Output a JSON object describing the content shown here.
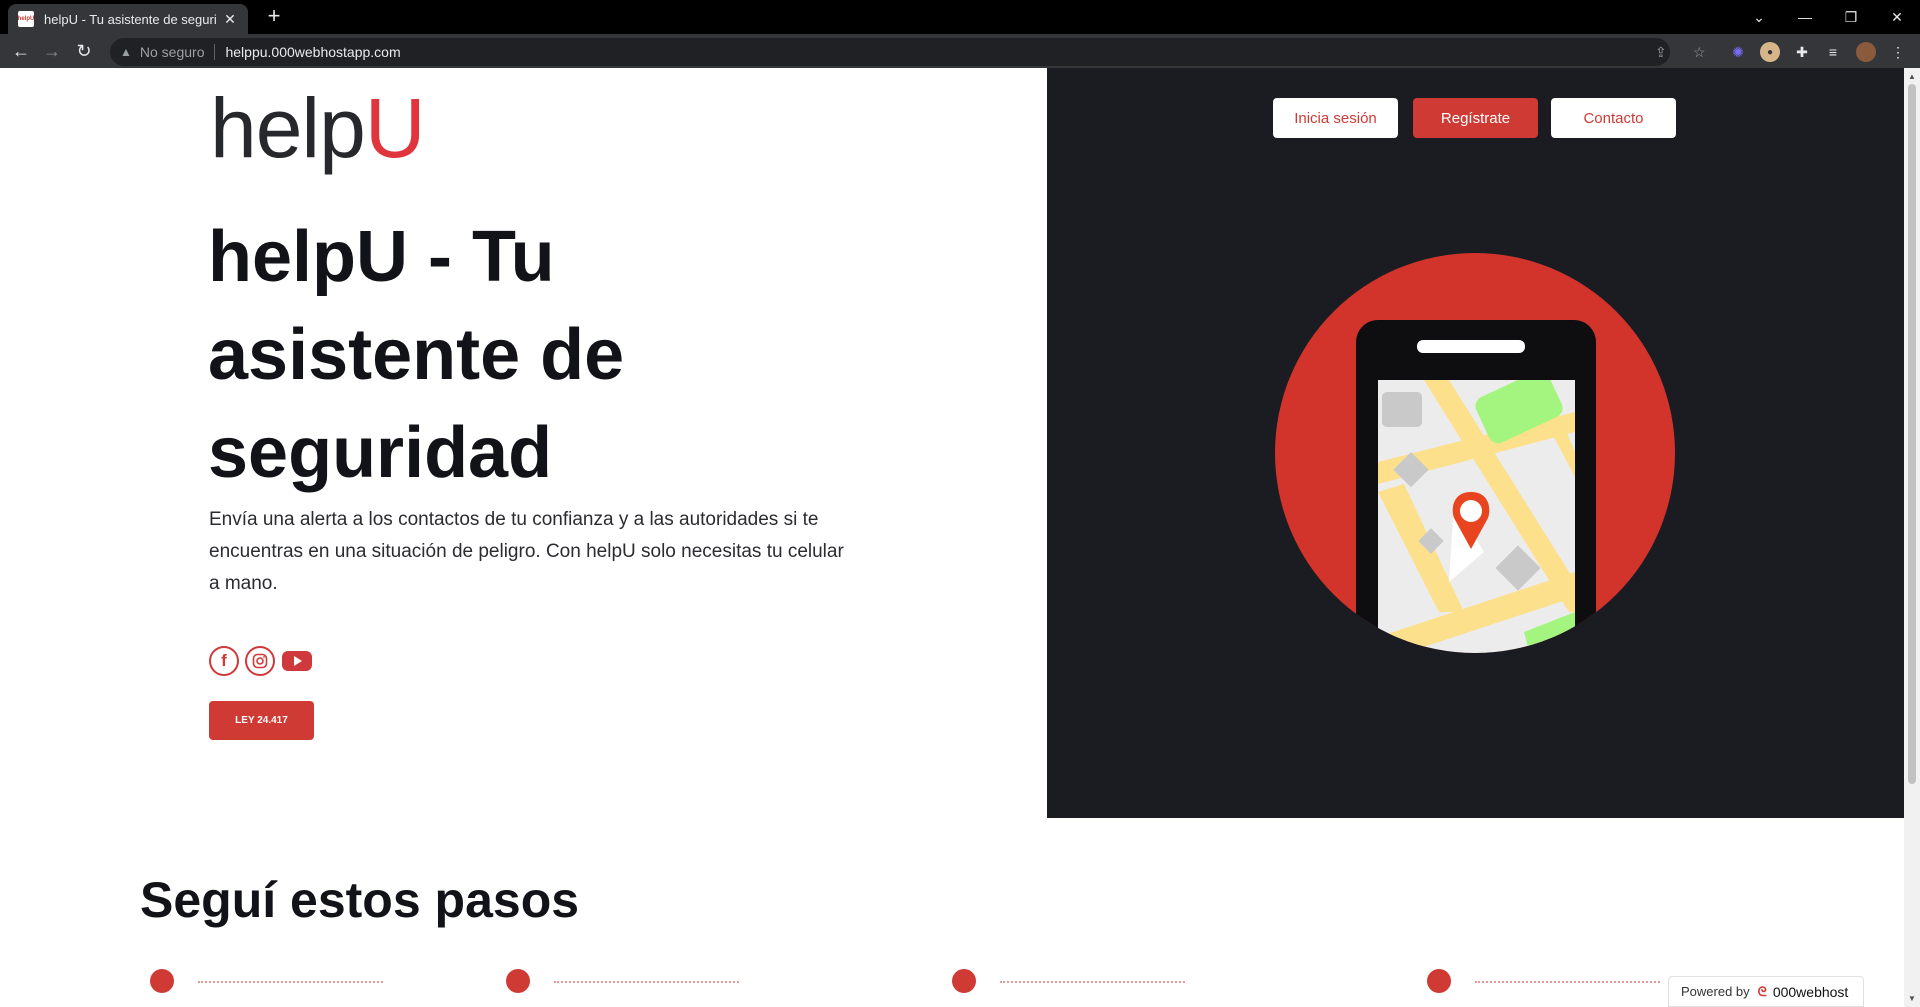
{
  "browser": {
    "tab_title": "helpU - Tu asistente de seguridad",
    "tab_favicon_text": "helpU",
    "not_secure_label": "No seguro",
    "url": "helppu.000webhostapp.com"
  },
  "logo": {
    "part1": "help",
    "part2": "U"
  },
  "hero": {
    "title": "helpU - Tu asistente de seguridad",
    "description": "Envía una alerta a los contactos de tu confianza y a las autoridades si te encuentras en una situación de peligro. Con helpU solo necesitas tu celular a mano.",
    "ley_button": "LEY 24.417"
  },
  "nav": {
    "login": "Inicia sesión",
    "register": "Regístrate",
    "contact": "Contacto"
  },
  "steps": {
    "title": "Seguí estos pasos"
  },
  "footer_badge": {
    "powered_by": "Powered by",
    "brand": "000webhost"
  },
  "colors": {
    "accent": "#d03a34",
    "dark_panel": "#1b1c21",
    "logo_u": "#e1353e"
  }
}
